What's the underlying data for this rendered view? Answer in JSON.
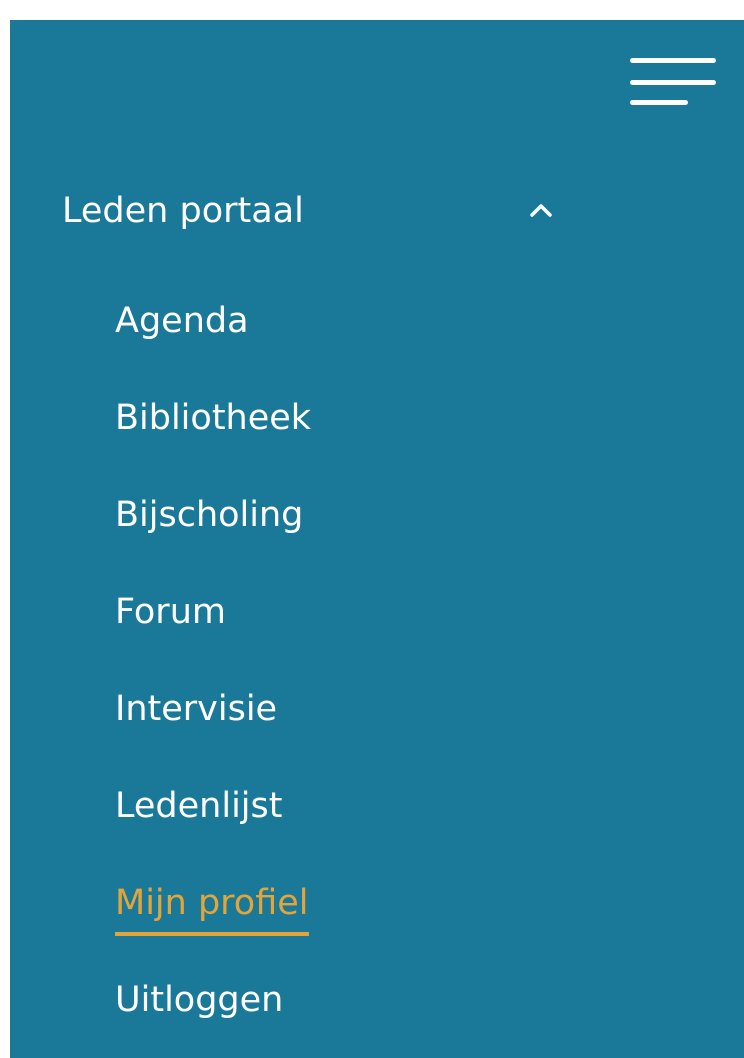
{
  "colors": {
    "panel_background": "#1a7899",
    "text": "#ffffff",
    "active_accent": "#e2a53a"
  },
  "header": {
    "menu_icon": "hamburger-menu-icon"
  },
  "section": {
    "label": "Leden portaal",
    "expanded": true,
    "toggle_icon": "chevron-up-icon"
  },
  "submenu": {
    "items": [
      {
        "label": "Agenda",
        "active": false
      },
      {
        "label": "Bibliotheek",
        "active": false
      },
      {
        "label": "Bijscholing",
        "active": false
      },
      {
        "label": "Forum",
        "active": false
      },
      {
        "label": "Intervisie",
        "active": false
      },
      {
        "label": "Ledenlijst",
        "active": false
      },
      {
        "label": "Mijn profiel",
        "active": true
      },
      {
        "label": "Uitloggen",
        "active": false
      }
    ]
  }
}
